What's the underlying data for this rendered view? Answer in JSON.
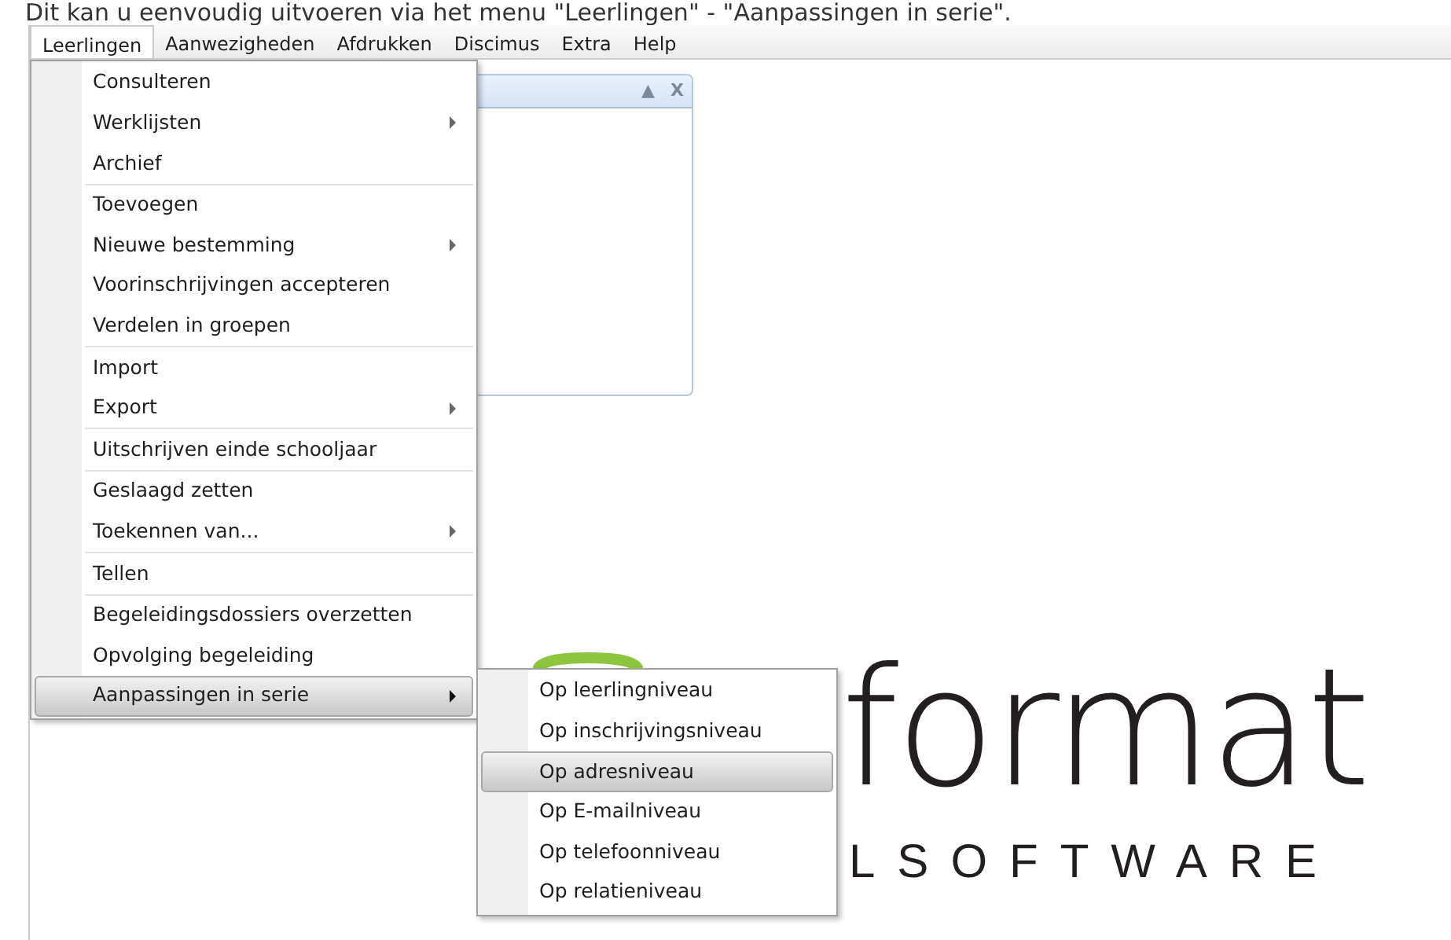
{
  "caption": "Dit kan u eenvoudig uitvoeren via het menu \"Leerlingen\" - \"Aanpassingen in serie\".",
  "menubar": [
    {
      "label": "Leerlingen",
      "selected": true
    },
    {
      "label": "Aanwezigheden",
      "selected": false
    },
    {
      "label": "Afdrukken",
      "selected": false
    },
    {
      "label": "Discimus",
      "selected": false
    },
    {
      "label": "Extra",
      "selected": false
    },
    {
      "label": "Help",
      "selected": false
    }
  ],
  "panel": {
    "collapse": "▲",
    "close": "X"
  },
  "menu": [
    [
      {
        "label": "Consulteren",
        "submenu": false,
        "selected": false
      },
      {
        "label": "Werklijsten",
        "submenu": true,
        "selected": false
      },
      {
        "label": "Archief",
        "submenu": false,
        "selected": false
      }
    ],
    [
      {
        "label": "Toevoegen",
        "submenu": false,
        "selected": false
      },
      {
        "label": "Nieuwe bestemming",
        "submenu": true,
        "selected": false
      },
      {
        "label": "Voorinschrijvingen accepteren",
        "submenu": false,
        "selected": false
      },
      {
        "label": "Verdelen in groepen",
        "submenu": false,
        "selected": false
      }
    ],
    [
      {
        "label": "Import",
        "submenu": false,
        "selected": false
      },
      {
        "label": "Export",
        "submenu": true,
        "selected": false
      }
    ],
    [
      {
        "label": "Uitschrijven einde schooljaar",
        "submenu": false,
        "selected": false
      }
    ],
    [
      {
        "label": "Geslaagd zetten",
        "submenu": false,
        "selected": false
      },
      {
        "label": "Toekennen van...",
        "submenu": true,
        "selected": false
      }
    ],
    [
      {
        "label": "Tellen",
        "submenu": false,
        "selected": false
      }
    ],
    [
      {
        "label": "Begeleidingsdossiers overzetten",
        "submenu": false,
        "selected": false
      },
      {
        "label": "Opvolging begeleiding",
        "submenu": false,
        "selected": false
      },
      {
        "label": "Aanpassingen in serie",
        "submenu": true,
        "selected": true
      }
    ]
  ],
  "submenu": [
    {
      "label": "Op leerlingniveau",
      "selected": false
    },
    {
      "label": "Op inschrijvingsniveau",
      "selected": false
    },
    {
      "label": "Op adresniveau",
      "selected": true
    },
    {
      "label": "Op E-mailniveau",
      "selected": false
    },
    {
      "label": "Op telefoonniveau",
      "selected": false
    },
    {
      "label": "Op relatieniveau",
      "selected": false
    }
  ],
  "logo": {
    "word": "format",
    "tagline": "LSOFTWARE"
  }
}
